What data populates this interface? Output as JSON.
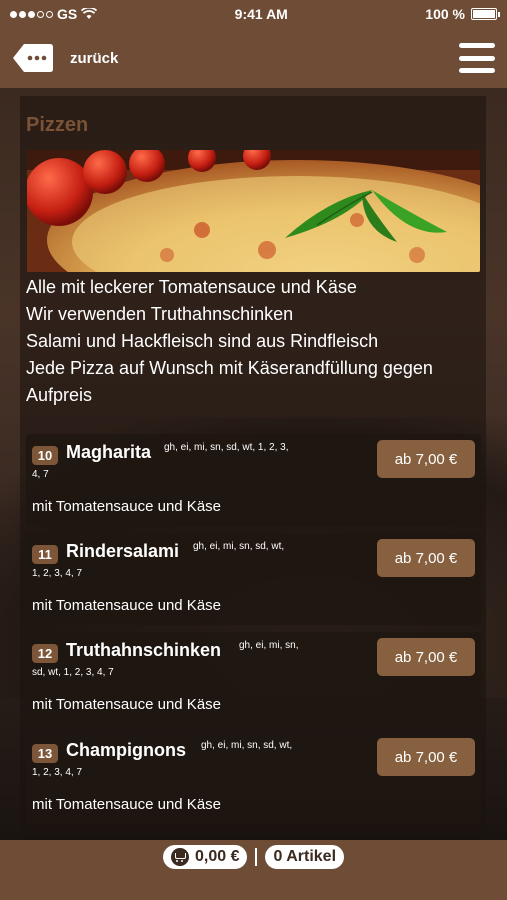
{
  "status": {
    "carrier": "GS",
    "time": "9:41 AM",
    "battery": "100 %",
    "battery_level": 1.0
  },
  "nav": {
    "back_label": "zurück"
  },
  "section": {
    "title": "Pizzen",
    "info": [
      "Alle mit leckerer Tomatensauce und Käse",
      "Wir verwenden Truthahnschinken",
      "Salami und Hackfleisch sind aus Rindfleisch",
      "Jede Pizza auf Wunsch mit Käserandfüllung gegen",
      "Aufpreis"
    ]
  },
  "items": [
    {
      "num": "10",
      "name": "Magharita",
      "allergens_1": "gh, ei, mi, sn, sd, wt, 1, 2, 3,",
      "allergens_2": "4, 7",
      "desc": "mit Tomatensauce und Käse",
      "price": "ab 7,00 €"
    },
    {
      "num": "11",
      "name": "Rindersalami",
      "allergens_1": "gh, ei, mi, sn, sd, wt,",
      "allergens_2": "1, 2, 3, 4, 7",
      "desc": "mit Tomatensauce und Käse",
      "price": "ab 7,00 €"
    },
    {
      "num": "12",
      "name": "Truthahnschinken",
      "allergens_1": "gh, ei, mi, sn,",
      "allergens_2": "sd, wt, 1, 2, 3, 4, 7",
      "desc": "mit Tomatensauce und Käse",
      "price": "ab 7,00 €"
    },
    {
      "num": "13",
      "name": "Champignons",
      "allergens_1": "gh, ei, mi, sn, sd, wt,",
      "allergens_2": "1, 2, 3, 4, 7",
      "desc": "mit Tomatensauce und Käse",
      "price": "ab 7,00 €"
    }
  ],
  "cart": {
    "total": "0,00 €",
    "divider": "|",
    "count": "0 Artikel"
  },
  "colors": {
    "bar": "#6e4c35",
    "accent": "#86603f",
    "title": "#7a5235"
  }
}
